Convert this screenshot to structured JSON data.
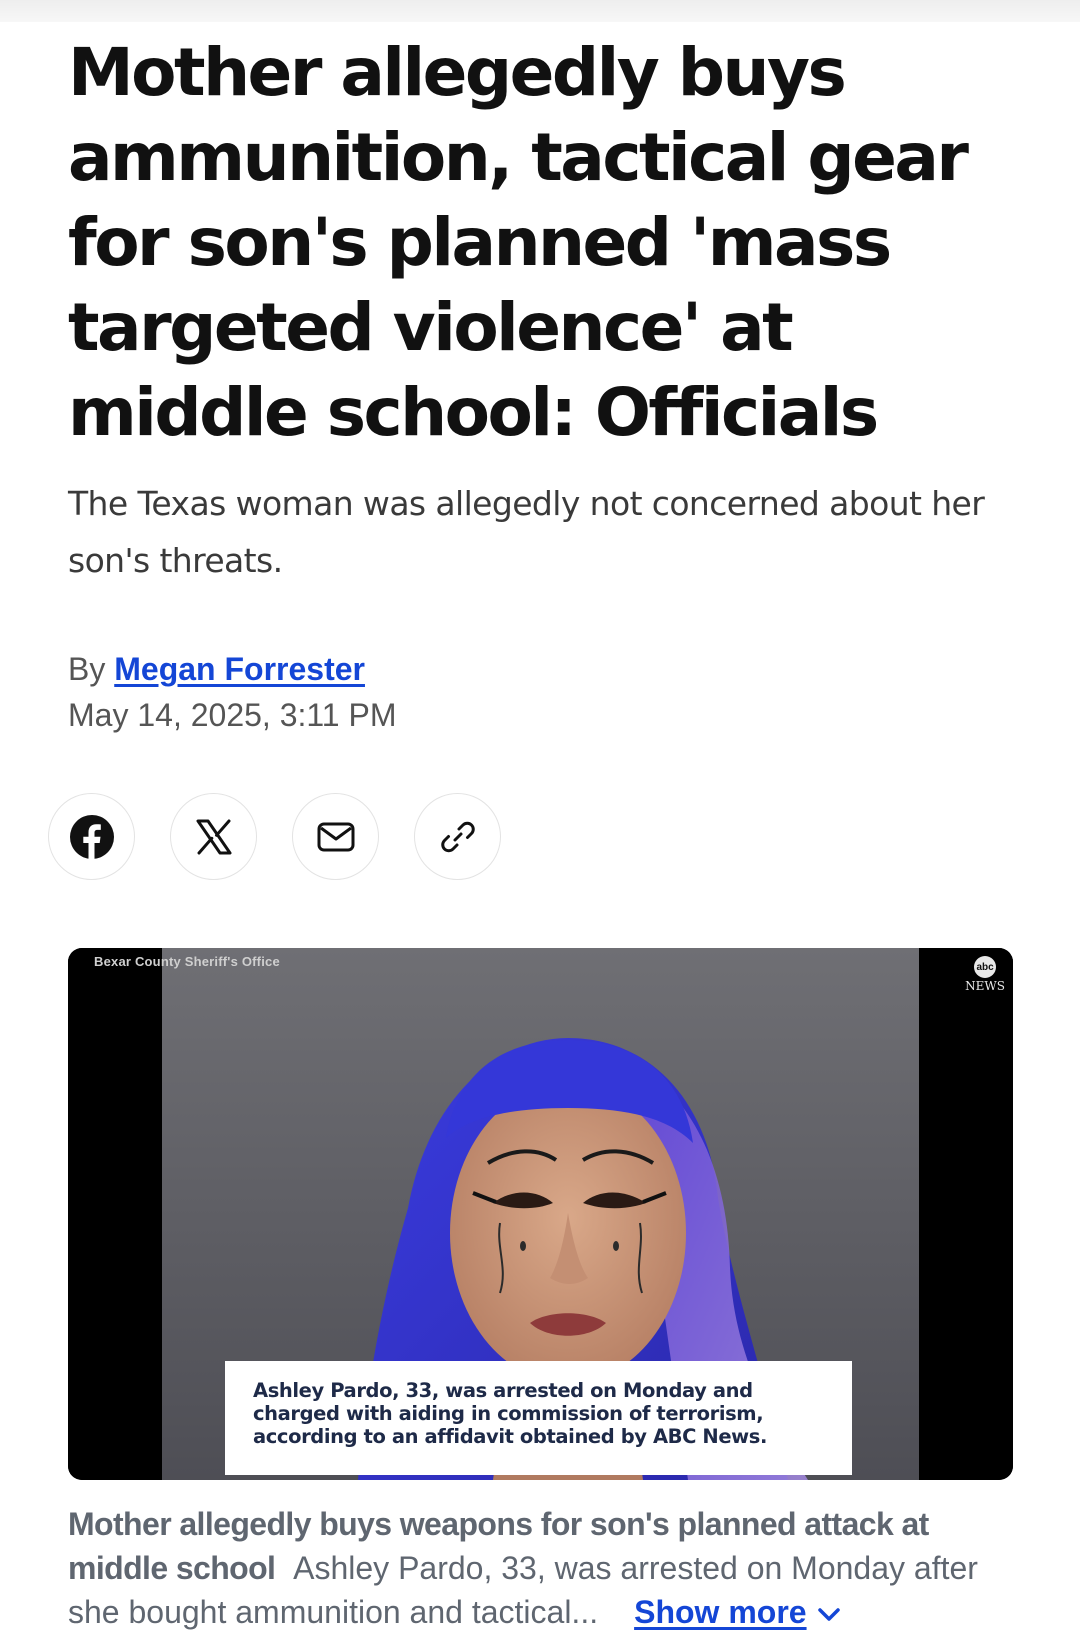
{
  "article": {
    "headline": "Mother allegedly buys ammunition, tactical gear for son's planned 'mass targeted violence' at middle school: Officials",
    "subheadline": "The Texas woman was allegedly not concerned about her son's threats.",
    "byline_prefix": "By",
    "author": "Megan Forrester",
    "date": "May 14, 2025, 3:11 PM"
  },
  "share": {
    "buttons": [
      {
        "name": "facebook",
        "icon": "facebook-icon"
      },
      {
        "name": "x",
        "icon": "x-icon"
      },
      {
        "name": "email",
        "icon": "mail-icon"
      },
      {
        "name": "copy-link",
        "icon": "link-icon"
      }
    ]
  },
  "media": {
    "credit": "Bexar County Sheriff's Office",
    "logo_text": "abc",
    "logo_news": "NEWS",
    "lower_third": "Ashley Pardo, 33, was arrested on Monday and charged with aiding in commission of terrorism, according to an affidavit obtained by ABC News."
  },
  "caption": {
    "title": "Mother allegedly buys weapons for son's planned attack at middle school",
    "body": "Ashley Pardo, 33, was arrested on Monday after she bought ammunition and tactical...",
    "show_more": "Show more"
  },
  "colors": {
    "link": "#1446d6",
    "headline": "#111111",
    "caption_text": "#5f6670"
  }
}
